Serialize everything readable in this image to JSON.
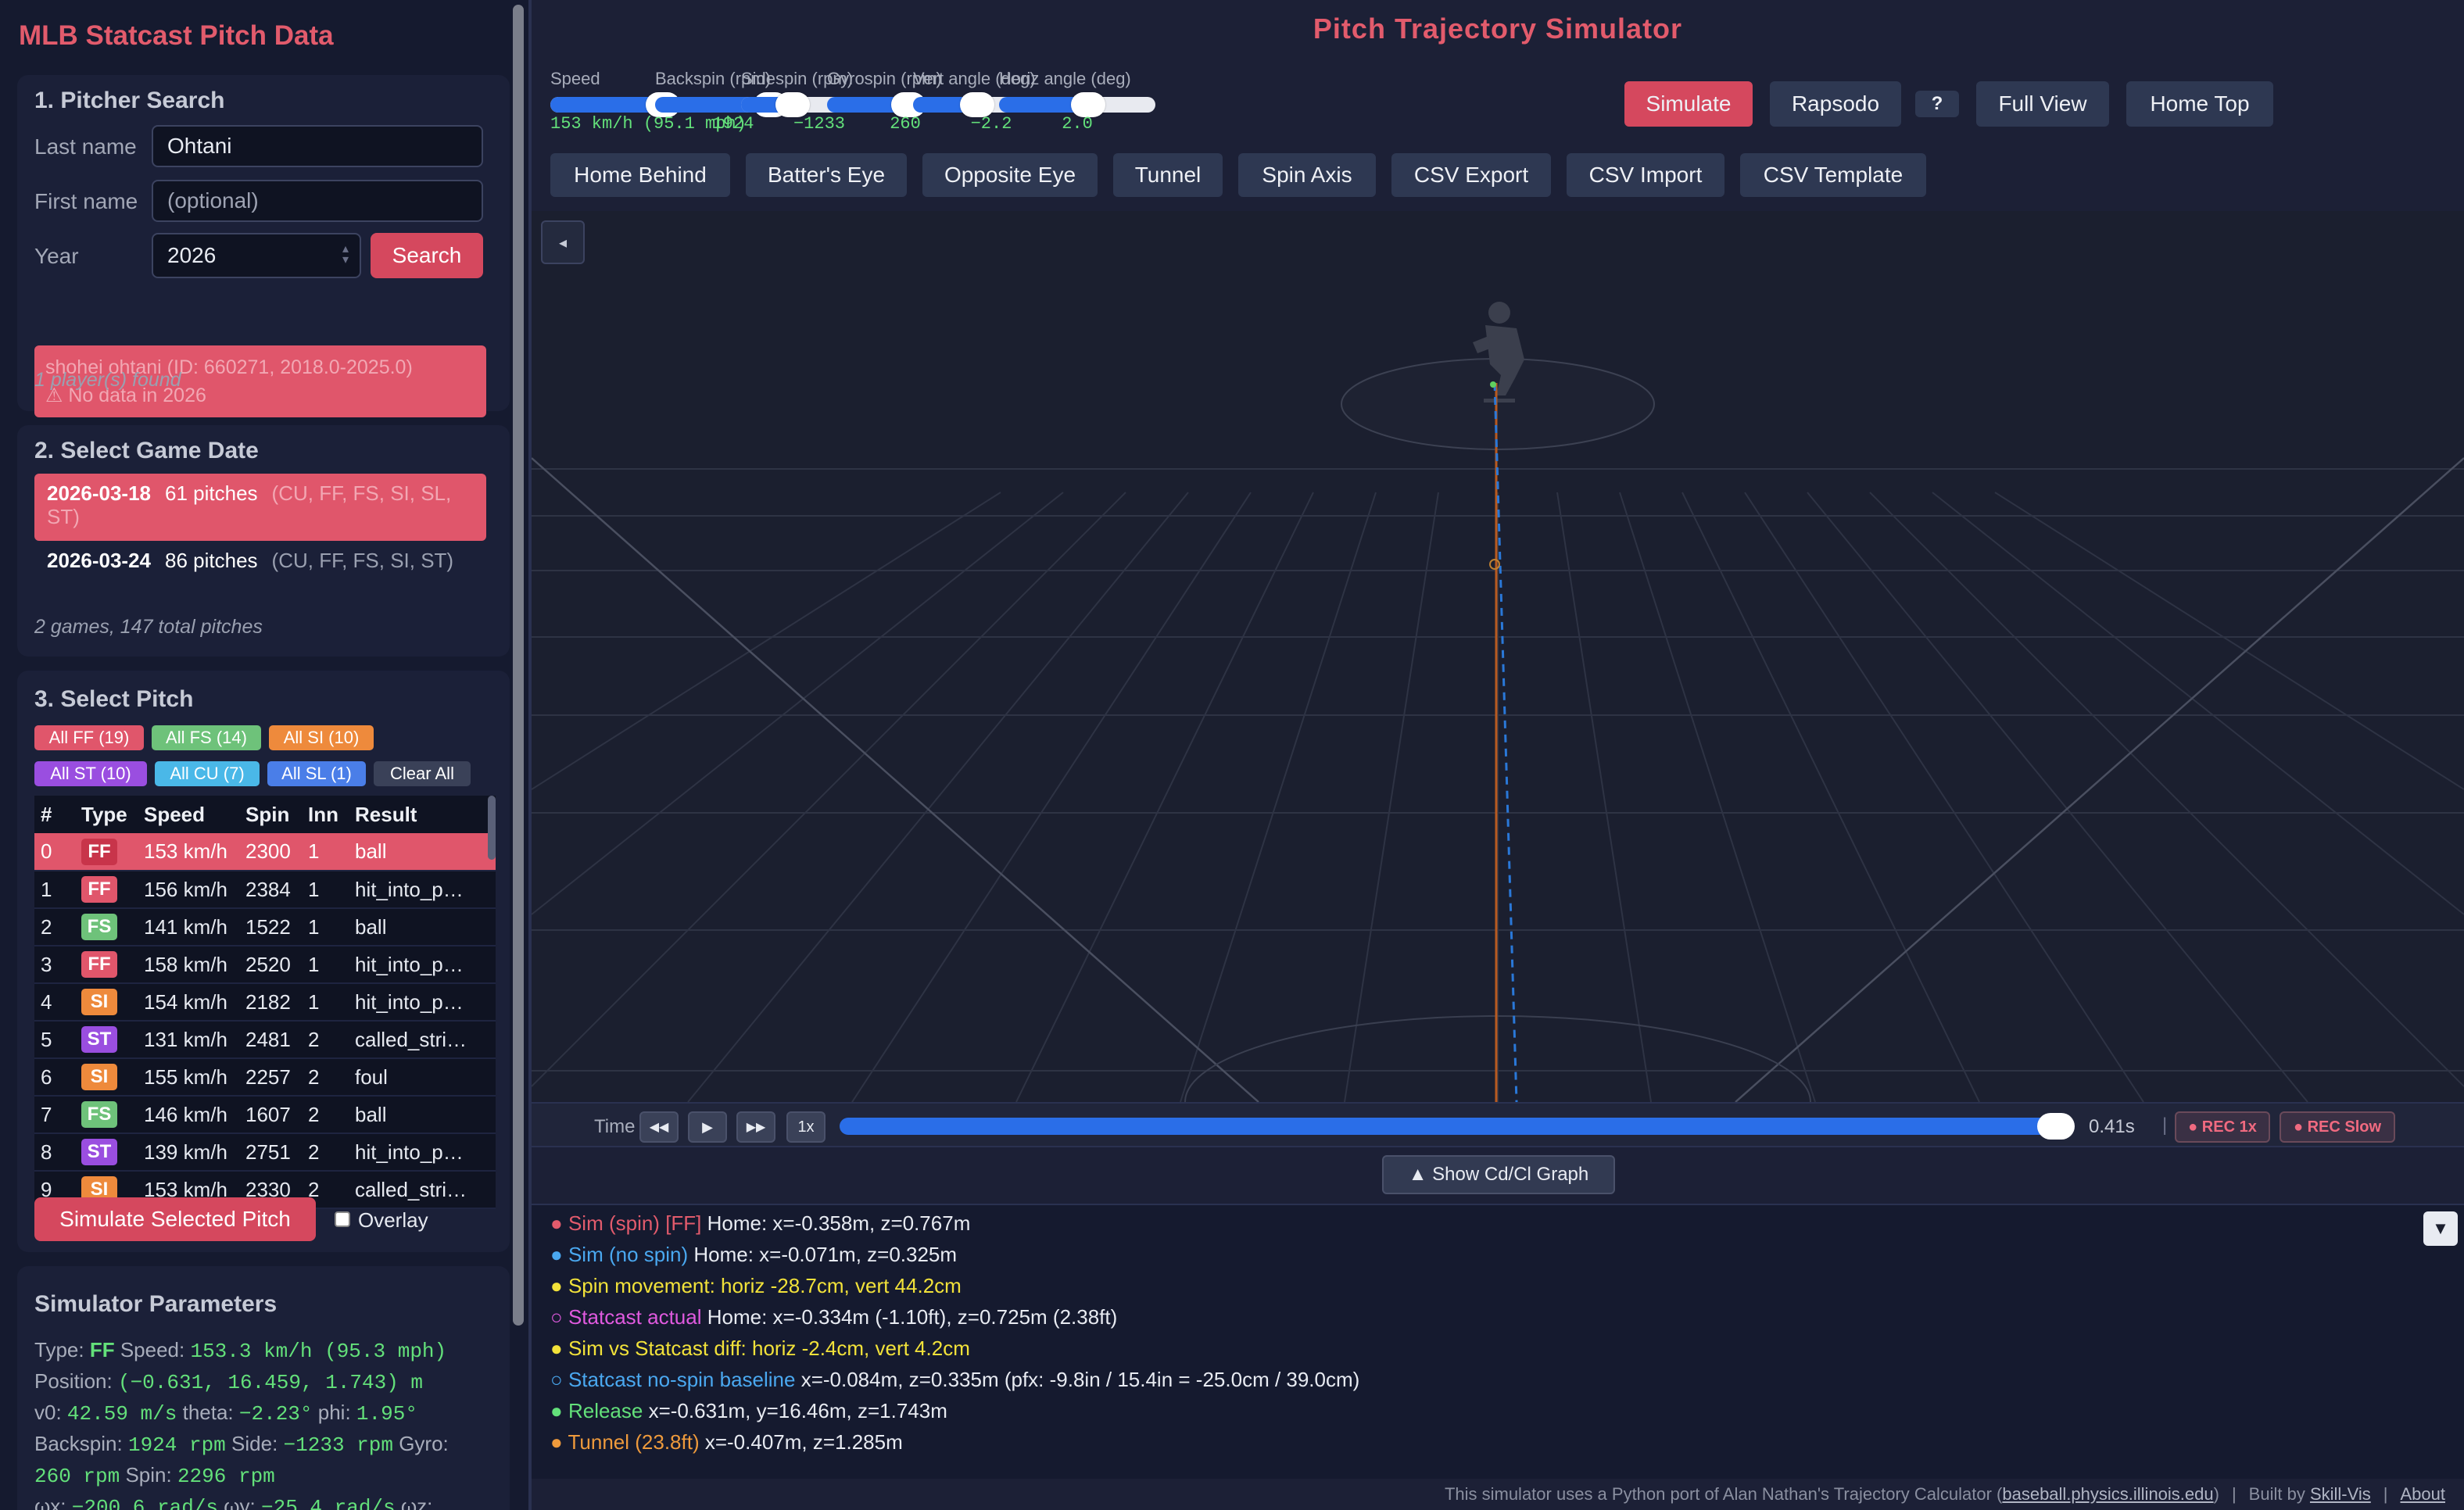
{
  "app_title": "MLB Statcast Pitch Data",
  "search": {
    "heading": "1. Pitcher Search",
    "last_label": "Last name",
    "last_value": "Ohtani",
    "first_label": "First name",
    "first_placeholder": "(optional)",
    "year_label": "Year",
    "year_value": "2026",
    "button": "Search",
    "error_line1": "shohei ohtani (ID: 660271, 2018.0-2025.0)",
    "error_line2": "⚠ No data in 2026",
    "found": "1 player(s) found"
  },
  "games": {
    "heading": "2. Select Game Date",
    "items": [
      {
        "date": "2026-03-18",
        "pitches": "61 pitches",
        "types": "(CU, FF, FS, SI, SL, ST)"
      },
      {
        "date": "2026-03-24",
        "pitches": "86 pitches",
        "types": "(CU, FF, FS, SI, ST)"
      }
    ],
    "summary": "2 games, 147 total pitches"
  },
  "pitches": {
    "heading": "3. Select Pitch",
    "chips": [
      {
        "label": "All FF (19)",
        "color": "#e0566b"
      },
      {
        "label": "All FS (14)",
        "color": "#6ec27a"
      },
      {
        "label": "All SI (10)",
        "color": "#ee8a3c"
      },
      {
        "label": "All ST (10)",
        "color": "#9a4ee0"
      },
      {
        "label": "All CU (7)",
        "color": "#4ab8e8"
      },
      {
        "label": "All SL (1)",
        "color": "#4a7ee8"
      },
      {
        "label": "Clear All",
        "color": "#3a4158"
      }
    ],
    "columns": [
      "#",
      "Type",
      "Speed",
      "Spin",
      "Inn",
      "Result"
    ],
    "rows": [
      {
        "n": "0",
        "type": "FF",
        "speed": "153 km/h",
        "spin": "2300",
        "inn": "1",
        "result": "ball"
      },
      {
        "n": "1",
        "type": "FF",
        "speed": "156 km/h",
        "spin": "2384",
        "inn": "1",
        "result": "hit_into_p…"
      },
      {
        "n": "2",
        "type": "FS",
        "speed": "141 km/h",
        "spin": "1522",
        "inn": "1",
        "result": "ball"
      },
      {
        "n": "3",
        "type": "FF",
        "speed": "158 km/h",
        "spin": "2520",
        "inn": "1",
        "result": "hit_into_p…"
      },
      {
        "n": "4",
        "type": "SI",
        "speed": "154 km/h",
        "spin": "2182",
        "inn": "1",
        "result": "hit_into_p…"
      },
      {
        "n": "5",
        "type": "ST",
        "speed": "131 km/h",
        "spin": "2481",
        "inn": "2",
        "result": "called_stri…"
      },
      {
        "n": "6",
        "type": "SI",
        "speed": "155 km/h",
        "spin": "2257",
        "inn": "2",
        "result": "foul"
      },
      {
        "n": "7",
        "type": "FS",
        "speed": "146 km/h",
        "spin": "1607",
        "inn": "2",
        "result": "ball"
      },
      {
        "n": "8",
        "type": "ST",
        "speed": "139 km/h",
        "spin": "2751",
        "inn": "2",
        "result": "hit_into_p…"
      },
      {
        "n": "9",
        "type": "SI",
        "speed": "153 km/h",
        "spin": "2330",
        "inn": "2",
        "result": "called_stri…"
      }
    ],
    "type_colors": {
      "FF": "#e0566b",
      "FS": "#6ec27a",
      "SI": "#ee8a3c",
      "ST": "#9a4ee0",
      "CU": "#4ab8e8",
      "SL": "#4a7ee8"
    },
    "simulate_button": "Simulate Selected Pitch",
    "overlay_label": "Overlay"
  },
  "params": {
    "heading": "Simulator Parameters",
    "type_label": "Type:",
    "type_value": "FF",
    "speed_label": "Speed:",
    "speed_value": "153.3 km/h (95.3 mph)",
    "position_label": "Position:",
    "position_value": "(−0.631, 16.459, 1.743) m",
    "v0_label": "v0:",
    "v0_value": "42.59 m/s",
    "theta_label": "theta:",
    "theta_value": "−2.23°",
    "phi_label": "phi:",
    "phi_value": "1.95°",
    "backspin_label": "Backspin:",
    "backspin_value": "1924 rpm",
    "side_label": "Side:",
    "side_value": "−1233 rpm",
    "gyro_label": "Gyro:",
    "gyro_value": "260 rpm",
    "spin_label": "Spin:",
    "spin_value": "2296 rpm",
    "wx_label": "ωx:",
    "wx_value": "−200.6 rad/s",
    "wy_label": "ωy:",
    "wy_value": "−25.4 rad/s",
    "wz_label": "ωz:"
  },
  "main_title": "Pitch Trajectory Simulator",
  "sliders": [
    {
      "label": "Speed",
      "value": "153 km/h (95.1 mph)",
      "fraction": 0.72
    },
    {
      "label": "Backspin (rpm)",
      "value": "1924",
      "fraction": 0.74
    },
    {
      "label": "Sidespin (rpm)",
      "value": "−1233",
      "fraction": 0.33
    },
    {
      "label": "Gyrospin (rpm)",
      "value": "260",
      "fraction": 0.52
    },
    {
      "label": "Vert angle (deg)",
      "value": "−2.2",
      "fraction": 0.41
    },
    {
      "label": "Horiz angle (deg)",
      "value": "2.0",
      "fraction": 0.57
    }
  ],
  "toolbar": {
    "simulate": "Simulate",
    "rapsodo": "Rapsodo",
    "help": "?",
    "full_view": "Full View",
    "home_top": "Home Top",
    "row2": [
      "Home Behind",
      "Batter's Eye",
      "Opposite Eye",
      "Tunnel",
      "Spin Axis",
      "CSV Export",
      "CSV Import",
      "CSV Template"
    ]
  },
  "viewport": {
    "collapse": "◂"
  },
  "timebar": {
    "label": "Time",
    "rewind": "◀◀",
    "play": "▶",
    "forward": "▶▶",
    "speed": "1x",
    "progress": 1.0,
    "time": "0.41s",
    "sep": "|",
    "rec1": "● REC 1x",
    "rec_slow": "● REC Slow"
  },
  "graph_button": "▲ Show Cd/Cl Graph",
  "info": {
    "toggle": "▼",
    "lines": [
      {
        "bullet": "●",
        "tag": "Sim (spin) [FF]",
        "text": " Home: x=-0.358m, z=0.767m",
        "color": "#e25b6c"
      },
      {
        "bullet": "●",
        "tag": "Sim (no spin)",
        "text": " Home: x=-0.071m, z=0.325m",
        "color": "#4aa8f0"
      },
      {
        "bullet": "●",
        "tag": "Spin movement: horiz -28.7cm, vert 44.2cm",
        "text": "",
        "color": "#f2e23a"
      },
      {
        "bullet": "○",
        "tag": "Statcast actual",
        "text": " Home: x=-0.334m (-1.10ft), z=0.725m (2.38ft)",
        "color": "#e05adf"
      },
      {
        "bullet": "●",
        "tag": "Sim vs Statcast diff: horiz -2.4cm, vert 4.2cm",
        "text": "",
        "color": "#f2e23a"
      },
      {
        "bullet": "○",
        "tag": "Statcast no-spin baseline",
        "text": " x=-0.084m, z=0.335m (pfx: -9.8in / 15.4in = -25.0cm / 39.0cm)",
        "color": "#4aa8f0"
      },
      {
        "bullet": "●",
        "tag": "Release",
        "text": " x=-0.631m, y=16.46m, z=1.743m",
        "color": "#63e07a"
      },
      {
        "bullet": "●",
        "tag": "Tunnel (23.8ft)",
        "text": " x=-0.407m, z=1.285m",
        "color": "#ee9a3c"
      }
    ]
  },
  "footer": {
    "text": "This simulator uses a Python port of Alan Nathan's Trajectory Calculator (",
    "link": "baseball.physics.illinois.edu",
    "close": ")",
    "sep1": "|",
    "built": "Built by",
    "builder": "Skill-Vis",
    "sep2": "|",
    "about": "About"
  }
}
